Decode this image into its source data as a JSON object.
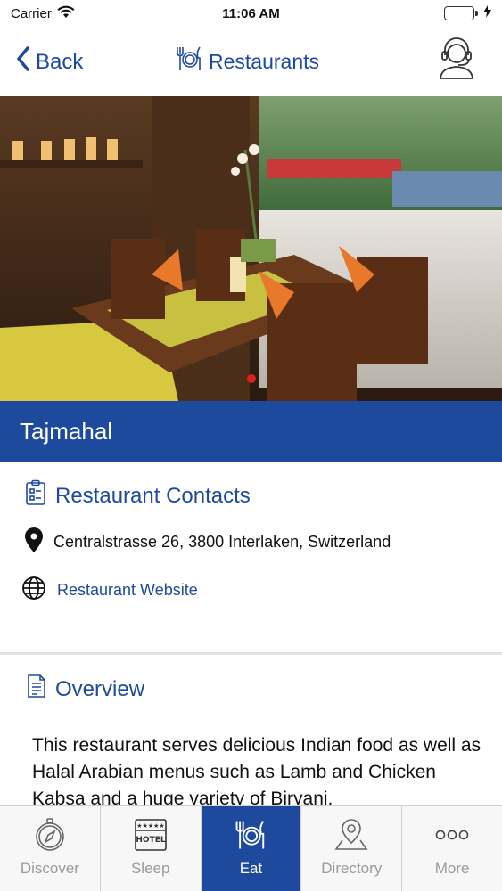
{
  "status_bar": {
    "carrier": "Carrier",
    "time": "11:06 AM"
  },
  "nav": {
    "back_label": "Back",
    "title": "Restaurants"
  },
  "restaurant": {
    "name": "Tajmahal"
  },
  "contacts": {
    "title": "Restaurant Contacts",
    "address": "Centralstrasse 26, 3800 Interlaken, Switzerland",
    "website_label": "Restaurant Website"
  },
  "overview": {
    "title": "Overview",
    "text": "This restaurant serves delicious Indian food as well as Halal Arabian menus such as Lamb and Chicken Kabsa and a huge variety of Biryani."
  },
  "tabs": [
    {
      "label": "Discover",
      "icon": "compass-icon"
    },
    {
      "label": "Sleep",
      "icon": "hotel-icon"
    },
    {
      "label": "Eat",
      "icon": "plate-cutlery-icon",
      "active": true
    },
    {
      "label": "Directory",
      "icon": "map-pin-icon"
    },
    {
      "label": "More",
      "icon": "more-dots-icon"
    }
  ],
  "colors": {
    "brand_blue": "#1d4a9c",
    "carousel_dot": "#e02020",
    "battery": "#4cd964"
  }
}
